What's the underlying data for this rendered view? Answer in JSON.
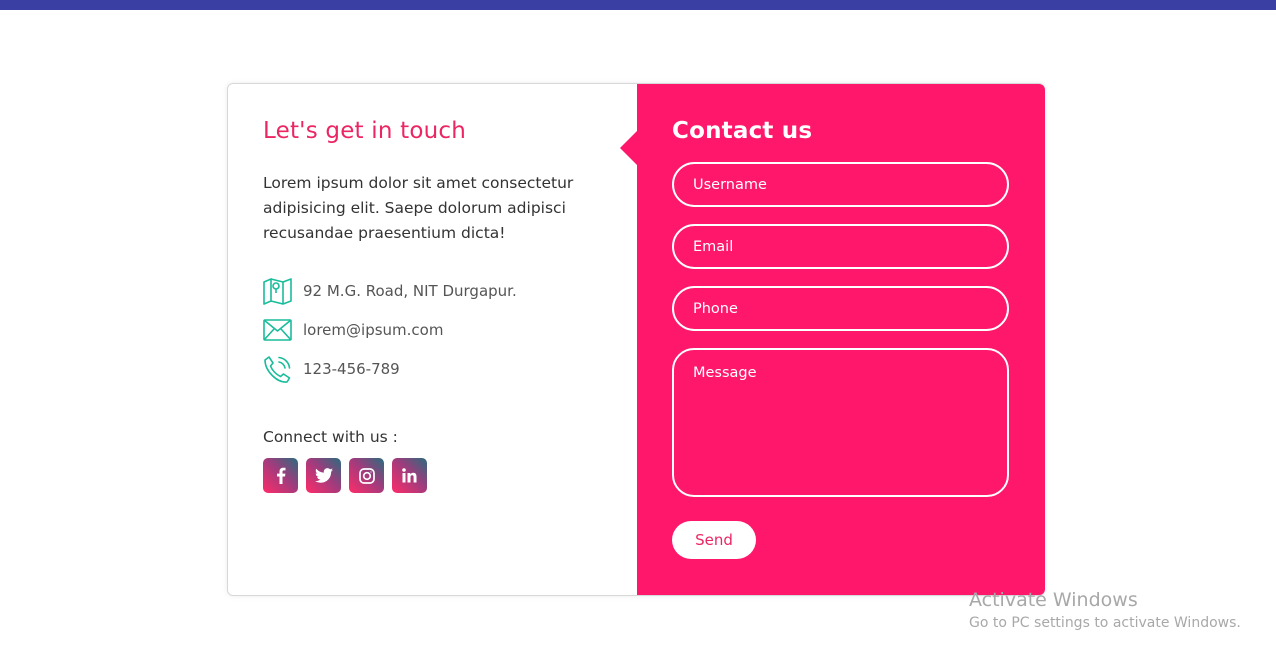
{
  "left": {
    "title": "Let's get in touch",
    "text": "Lorem ipsum dolor sit amet consectetur adipisicing elit. Saepe dolorum adipisci recusandae praesentium dicta!",
    "info": [
      {
        "icon": "map-icon",
        "text": "92 M.G. Road, NIT Durgapur."
      },
      {
        "icon": "envelope-icon",
        "text": "lorem@ipsum.com"
      },
      {
        "icon": "phone-icon",
        "text": "123-456-789"
      }
    ],
    "connect_label": "Connect with us :",
    "socials": [
      "facebook-icon",
      "twitter-icon",
      "instagram-icon",
      "linkedin-icon"
    ]
  },
  "form": {
    "title": "Contact us",
    "username_placeholder": "Username",
    "email_placeholder": "Email",
    "phone_placeholder": "Phone",
    "message_placeholder": "Message",
    "send_label": "Send"
  },
  "watermark": {
    "line1": "Activate Windows",
    "line2": "Go to PC settings to activate Windows."
  },
  "colors": {
    "accent": "#ff176b",
    "title": "#ec2563",
    "icon_teal": "#1abc9c",
    "topbar": "#3a3fa3"
  }
}
